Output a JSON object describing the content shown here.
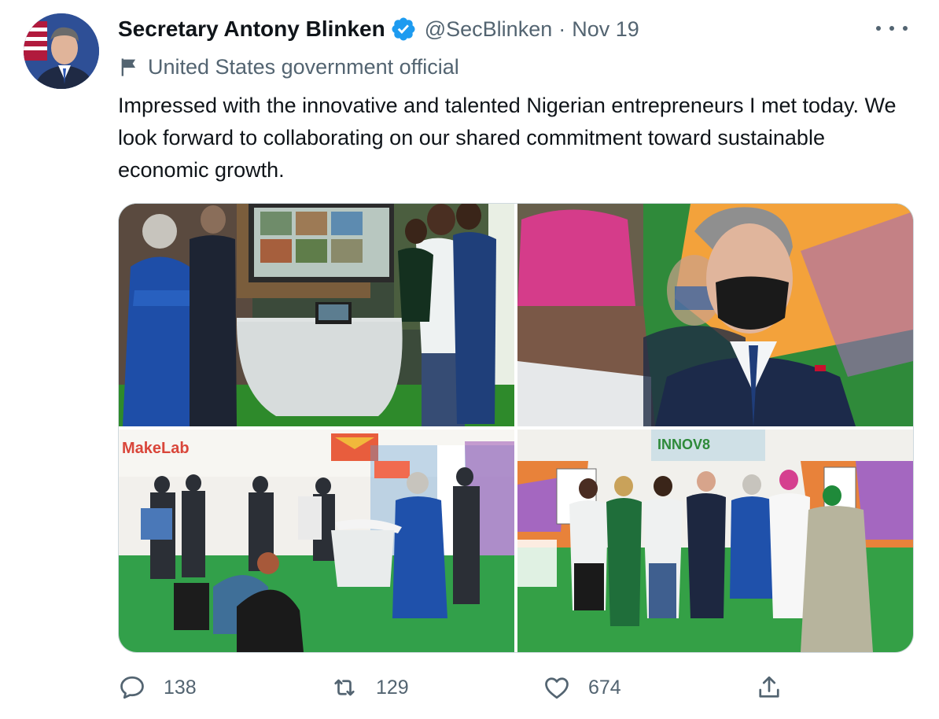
{
  "tweet": {
    "author": {
      "name": "Secretary Antony Blinken",
      "handle": "@SecBlinken",
      "verified_icon": "verified-badge-icon",
      "avatar_icon": "profile-avatar"
    },
    "separator": "·",
    "date": "Nov 19",
    "more_icon": "more-horizontal-icon",
    "label": {
      "icon": "flag-icon",
      "text": "United States government official"
    },
    "text": "Impressed with the innovative and talented Nigerian entrepreneurs I met today. We look forward to collaborating on our shared commitment toward sustainable economic growth.",
    "media": {
      "count": 4,
      "photos": [
        {
          "id": "photo-1",
          "alt_icon": "photo-tech-lab-visit"
        },
        {
          "id": "photo-2",
          "alt_icon": "photo-masked-secretary-closeup"
        },
        {
          "id": "photo-3",
          "alt_icon": "photo-makelab-drone-demo"
        },
        {
          "id": "photo-4",
          "alt_icon": "photo-group-photo-innov8"
        }
      ]
    },
    "actions": {
      "reply": {
        "icon": "reply-icon",
        "count": "138"
      },
      "retweet": {
        "icon": "retweet-icon",
        "count": "129"
      },
      "like": {
        "icon": "heart-icon",
        "count": "674"
      },
      "share": {
        "icon": "share-icon"
      }
    }
  },
  "colors": {
    "text_primary": "#0f1419",
    "text_secondary": "#536471",
    "verified_blue": "#1d9bf0",
    "border": "#cfd9de"
  }
}
